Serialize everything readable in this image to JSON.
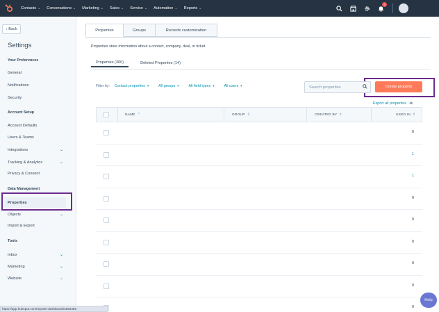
{
  "topnav": {
    "links": [
      {
        "label": "Contacts"
      },
      {
        "label": "Conversations"
      },
      {
        "label": "Marketing"
      },
      {
        "label": "Sales"
      },
      {
        "label": "Service"
      },
      {
        "label": "Automation"
      },
      {
        "label": "Reports"
      }
    ],
    "notification_count": "3",
    "background": "#253342"
  },
  "sidebar": {
    "back_label": "Back",
    "title": "Settings",
    "sections": {
      "preferences": "Your Preferences",
      "account_setup": "Account Setup",
      "data_management": "Data Management",
      "tools": "Tools"
    },
    "items": {
      "general": "General",
      "notifications": "Notifications",
      "security": "Security",
      "account_defaults": "Account Defaults",
      "users_teams": "Users & Teams",
      "integrations": "Integrations",
      "tracking_analytics": "Tracking & Analytics",
      "privacy_consent": "Privacy & Consent",
      "properties": "Properties",
      "objects": "Objects",
      "import_export": "Import & Export",
      "inbox": "Inbox",
      "marketing": "Marketing",
      "website": "Website"
    }
  },
  "main": {
    "tabs": [
      "Properties",
      "Groups",
      "Records customization"
    ],
    "description": "Properties store information about a contact, company, deal, or ticket.",
    "subtabs": [
      "Properties (300)",
      "Deleted Properties (14)"
    ],
    "filter_label": "Filter by:",
    "filters": [
      "Contact properties",
      "All groups",
      "All field types",
      "All users"
    ],
    "search_placeholder": "Search properties",
    "create_button": "Create property",
    "export_link": "Export all properties",
    "table": {
      "columns": [
        "NAME",
        "GROUP",
        "CREATED BY",
        "USED IN"
      ],
      "used_in": [
        "0",
        "1",
        "1",
        "0",
        "0",
        "0",
        "0",
        "0",
        "0"
      ]
    }
  },
  "statusbar_url": "https://app.hubspot.com/reports-dashboard/2860466",
  "help_label": "Help",
  "colors": {
    "accent": "#ff7a59",
    "link": "#0091ae",
    "highlight": "#6a2a8f"
  }
}
